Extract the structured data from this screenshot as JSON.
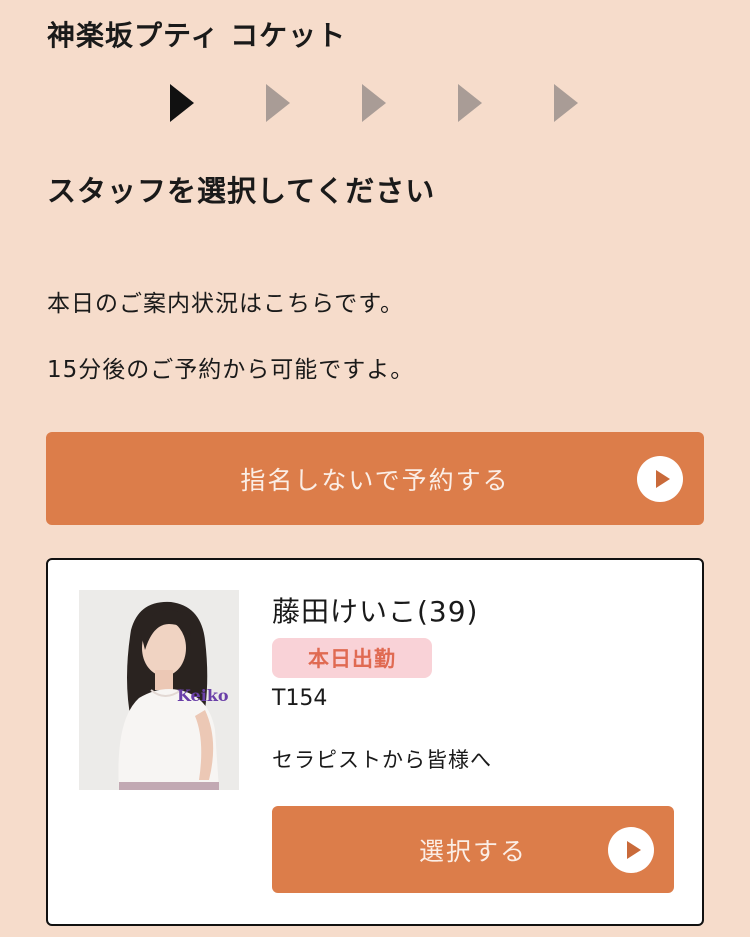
{
  "shop": {
    "title": "神楽坂プティ コケット"
  },
  "steps": {
    "count": 5,
    "current": 1
  },
  "page": {
    "heading": "スタッフを選択してください",
    "info_line1": "本日のご案内状況はこちらです。",
    "info_line2": "15分後のご予約から可能ですよ。"
  },
  "no_nomination_button": {
    "label": "指名しないで予約する",
    "icon": "play-circle-icon"
  },
  "staff": {
    "name": "藤田けいこ(39)",
    "badge": "本日出勤",
    "size": "T154",
    "message_link": "セラピストから皆様へ",
    "photo_caption": "Keiko",
    "select_button": {
      "label": "選択する",
      "icon": "play-circle-icon"
    }
  },
  "colors": {
    "background": "#f6dccb",
    "accent": "#dc7d4a",
    "badge_bg": "#f9d2d7",
    "badge_text": "#e06a52",
    "step_active": "#111111",
    "step_inactive": "#a99c96"
  }
}
